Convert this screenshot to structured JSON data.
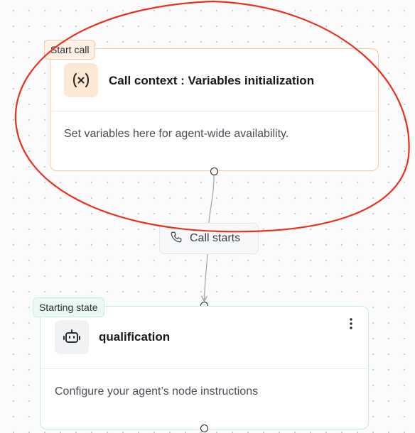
{
  "start_node": {
    "tag": "Start call",
    "title": "Call context : Variables initialization",
    "description": "Set variables here for agent-wide availability.",
    "icon": "variable-x-icon",
    "accent_color": "#f5c9a4"
  },
  "edge": {
    "label": "Call starts",
    "icon": "phone-icon"
  },
  "state_node": {
    "tag": "Starting state",
    "title": "qualification",
    "description": "Configure your agent’s node instructions",
    "icon": "robot-icon",
    "menu_icon": "more-vertical-icon",
    "accent_color": "#c8ede0"
  },
  "annotation": {
    "type": "ellipse",
    "color": "#e8321e"
  }
}
